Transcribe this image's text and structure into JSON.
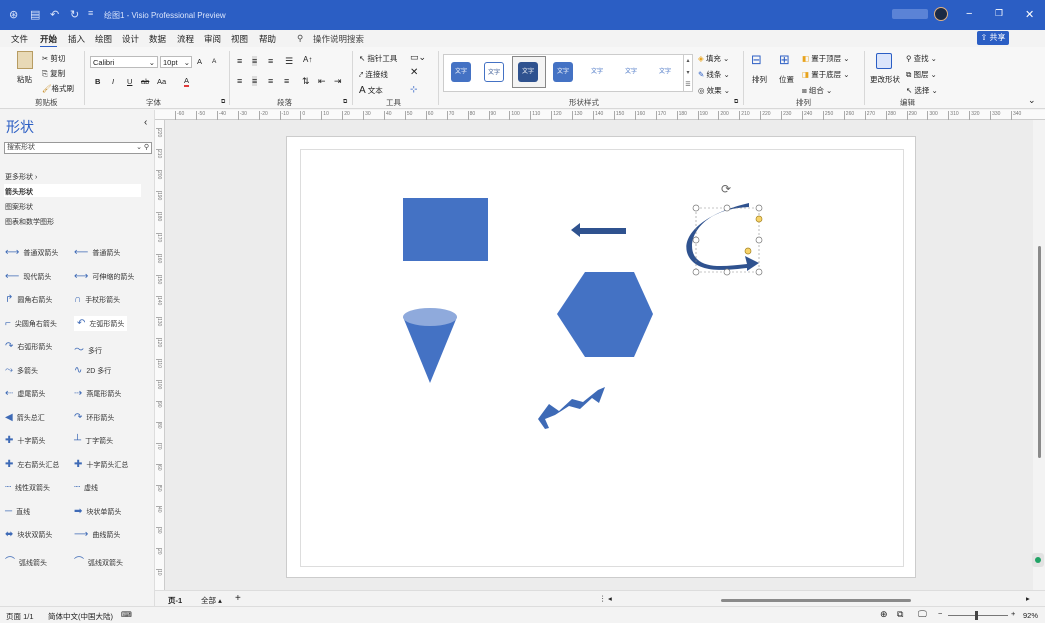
{
  "titlebar": {
    "doc_title": "绘图1 - Visio Professional Preview",
    "icons": [
      "autosave-icon",
      "save-icon",
      "undo-icon",
      "redo-icon",
      "customize-icon"
    ]
  },
  "menu": {
    "tabs": [
      "文件",
      "开始",
      "插入",
      "绘图",
      "设计",
      "数据",
      "流程",
      "审阅",
      "视图",
      "帮助"
    ],
    "active": "开始",
    "search_label": "操作说明搜索",
    "share_label": "共享"
  },
  "ribbon": {
    "clipboard": {
      "paste": "粘贴",
      "cut": "剪切",
      "copy": "复制",
      "format_painter": "格式刷",
      "label": "剪贴板"
    },
    "font": {
      "name": "Calibri",
      "size": "10pt",
      "label": "字体",
      "bold": "B",
      "italic": "I",
      "underline": "U",
      "strike": "ab",
      "case": "Aa",
      "color_a": "A",
      "grow": "A",
      "shrink": "A"
    },
    "paragraph": {
      "label": "段落"
    },
    "tools": {
      "pointer": "指针工具",
      "connector": "连接线",
      "text": "文本",
      "label": "工具"
    },
    "shape_styles": {
      "label": "形状样式",
      "swatch_text": "文字",
      "fill": "填充",
      "line": "线条",
      "effect": "效果"
    },
    "arrange": {
      "arrange": "排列",
      "position": "位置",
      "bring_front": "置于顶层",
      "send_back": "置于底层",
      "group": "组合",
      "label": "排列"
    },
    "editing": {
      "change_shape": "更改形状",
      "find": "查找",
      "layers": "图层",
      "select": "选择",
      "label": "编辑"
    }
  },
  "panel": {
    "title": "形状",
    "search_placeholder": "搜索形状",
    "more_shapes": "更多形状",
    "stencils": [
      "箭头形状",
      "图案形状",
      "图表和数学图形"
    ],
    "shapes": [
      [
        "普通双箭头",
        "普通箭头"
      ],
      [
        "现代箭头",
        "可伸缩的箭头"
      ],
      [
        "圆角右箭头",
        "手杖形箭头"
      ],
      [
        "尖圆角右箭头",
        "左弧形箭头"
      ],
      [
        "右弧形箭头",
        "多行"
      ],
      [
        "多箭头",
        "2D 多行"
      ],
      [
        "虚尾箭头",
        "燕尾形箭头"
      ],
      [
        "箭头总汇",
        "环形箭头"
      ],
      [
        "十字箭头",
        "丁字箭头"
      ],
      [
        "左右箭头汇总",
        "十字箭头汇总"
      ],
      [
        "线性双箭头",
        "虚线"
      ],
      [
        "直线",
        "块状单箭头"
      ],
      [
        "块状双箭头",
        "曲线箭头"
      ],
      [
        "弧线箭头",
        "弧线双箭头"
      ]
    ]
  },
  "ruler": {
    "h_ticks": [
      "-60",
      "-50",
      "-40",
      "-30",
      "-20",
      "-10",
      "0",
      "10",
      "20",
      "30",
      "40",
      "50",
      "60",
      "70",
      "80",
      "90",
      "100",
      "110",
      "120",
      "130",
      "140",
      "150",
      "160",
      "170",
      "180",
      "190",
      "200",
      "210",
      "220",
      "230",
      "240",
      "250",
      "260",
      "270",
      "280",
      "290",
      "300",
      "310",
      "320",
      "330",
      "340"
    ],
    "v_ticks": [
      "220",
      "210",
      "200",
      "190",
      "180",
      "170",
      "160",
      "150",
      "140",
      "130",
      "120",
      "110",
      "100",
      "90",
      "80",
      "70",
      "60",
      "50",
      "40",
      "30",
      "20",
      "10"
    ]
  },
  "pages": {
    "current": "页-1",
    "all": "全部"
  },
  "status": {
    "page": "页面 1/1",
    "language": "简体中文(中国大陆)",
    "zoom": "92%"
  },
  "colors": {
    "accent": "#2b5ec4",
    "shape_fill": "#4472c4",
    "shape_dark": "#2f528f"
  }
}
